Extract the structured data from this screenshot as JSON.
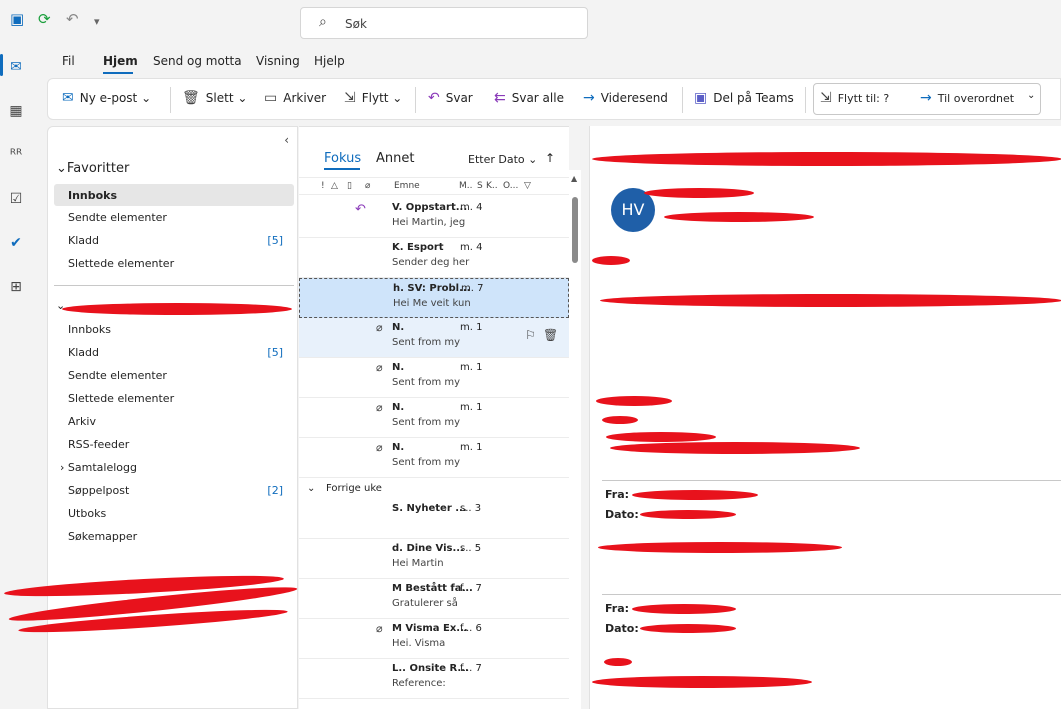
{
  "titlebar": {
    "search_placeholder": "Søk"
  },
  "menu": {
    "items": [
      "Fil",
      "Hjem",
      "Send og motta",
      "Visning",
      "Hjelp"
    ]
  },
  "ribbon": {
    "new_email": "Ny e-post",
    "delete": "Slett",
    "archive": "Arkiver",
    "move": "Flytt",
    "reply": "Svar",
    "reply_all": "Svar alle",
    "forward": "Videresend",
    "share_teams": "Del på Teams",
    "move_to": "Flytt til: ?",
    "to_manager": "Til overordnet"
  },
  "folders": {
    "favorites_header": "Favoritter",
    "favorites": [
      {
        "label": "Innboks",
        "count": ""
      },
      {
        "label": "Sendte elementer",
        "count": ""
      },
      {
        "label": "Kladd",
        "count": "[5]"
      },
      {
        "label": "Slettede elementer",
        "count": ""
      }
    ],
    "account": [
      {
        "label": "Innboks",
        "count": ""
      },
      {
        "label": "Kladd",
        "count": "[5]"
      },
      {
        "label": "Sendte elementer",
        "count": ""
      },
      {
        "label": "Slettede elementer",
        "count": ""
      },
      {
        "label": "Arkiv",
        "count": ""
      },
      {
        "label": "RSS-feeder",
        "count": ""
      },
      {
        "label": "Samtalelogg",
        "count": ""
      },
      {
        "label": "Søppelpost",
        "count": "[2]"
      },
      {
        "label": "Utboks",
        "count": ""
      },
      {
        "label": "Søkemapper",
        "count": ""
      }
    ]
  },
  "list": {
    "tab_focus": "Fokus",
    "tab_other": "Annet",
    "sort": "Etter Dato",
    "columns": [
      "Emne",
      "M..",
      "S",
      "K..",
      "O..."
    ],
    "group_previous": "Forrige uke",
    "rows": [
      {
        "sender": "V. Oppstart...",
        "date": "m. 4",
        "preview": "Hei Martin, jeg"
      },
      {
        "sender": "K. Esport",
        "date": "m. 4",
        "preview": "Sender deg her"
      },
      {
        "sender": "h. SV: Probl...",
        "date": "m. 7",
        "preview": "Hei  Me veit kun"
      },
      {
        "sender": "N.",
        "date": "m. 1",
        "preview": "Sent from my"
      },
      {
        "sender": "N.",
        "date": "m. 1",
        "preview": "Sent from my"
      },
      {
        "sender": "N.",
        "date": "m. 1",
        "preview": "Sent from my"
      },
      {
        "sender": "N.",
        "date": "m. 1",
        "preview": "Sent from my"
      }
    ],
    "rows2": [
      {
        "sender": "S. Nyheter ...",
        "date": "s.. 3",
        "preview": ""
      },
      {
        "sender": "d. Dine Vis...",
        "date": "s.. 5",
        "preview": "Hei Martin"
      },
      {
        "sender": "M Bestått fa...",
        "date": "f... 7",
        "preview": "Gratulerer så"
      },
      {
        "sender": "M Visma Ex...",
        "date": "f... 6",
        "preview": "Hei.  Visma"
      },
      {
        "sender": "L.. Onsite R...",
        "date": "f... 7",
        "preview": "Reference:"
      }
    ]
  },
  "reading": {
    "avatar": "HV",
    "from_label": "Fra:",
    "date_label": "Dato:"
  },
  "colors": {
    "accent": "#0f6cbd",
    "redaction": "#e8121c",
    "selection": "#cfe4fa"
  }
}
